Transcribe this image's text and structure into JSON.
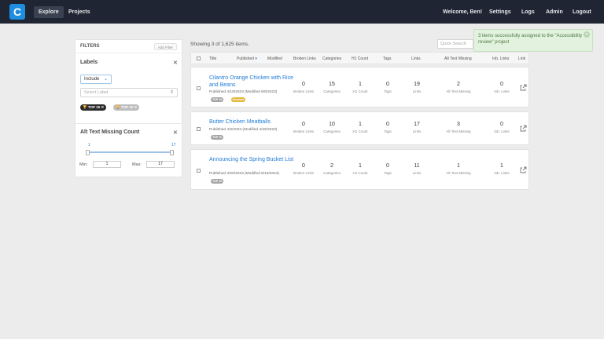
{
  "nav": {
    "logo": "C",
    "explore": "Explore",
    "projects": "Projects",
    "welcome": "Welcome, Ben!",
    "settings": "Settings",
    "logs": "Logs",
    "admin": "Admin",
    "logout": "Logout"
  },
  "filters": {
    "title": "FILTERS",
    "add_filter": "Add Filter",
    "labels": {
      "title": "Labels",
      "include": "Include",
      "select_placeholder": "Select Label",
      "chips": [
        "TOP 25",
        "TOP 10"
      ]
    },
    "alt_text": {
      "title": "Alt Text Missing Count",
      "slider_min": "1",
      "slider_max": "17",
      "min_label": "Min:",
      "max_label": "Max:",
      "min_value": "1",
      "max_value": "17"
    }
  },
  "main": {
    "showing": "Showing 3 of 1,625 items.",
    "search_placeholder": "Quick Search",
    "toast": "3 items successfully assigned to the \"Accessibility review\" project",
    "columns": [
      "Title",
      "Published",
      "Modified",
      "Broken Links",
      "Categories",
      "H1 Count",
      "Tags",
      "Links",
      "Alt Text Missing",
      "Inb. Links",
      "Link"
    ],
    "sub_labels": [
      "Broken Links",
      "Categories",
      "H1 Count",
      "Tags",
      "Links",
      "Alt Text Missing",
      "Inb. Links"
    ],
    "rows": [
      {
        "title": "Cilantro Orange Chicken with Rice and Beans",
        "meta": "Published 4/19/2023 (Modified 6/8/2023)",
        "tags": [
          "TOP 10",
          "Summer"
        ],
        "values": [
          "0",
          "15",
          "1",
          "0",
          "19",
          "2",
          "0"
        ]
      },
      {
        "title": "Butter Chicken Meatballs",
        "meta": "Published 4/3/2023 (Modified 4/26/2023)",
        "tags": [
          "TOP 10"
        ],
        "values": [
          "0",
          "10",
          "1",
          "0",
          "17",
          "3",
          "0"
        ]
      },
      {
        "title": "Announcing the Spring Bucket List",
        "meta": "Published 3/20/2023 (Modified 5/16/2023)",
        "tags": [
          "TOP 10"
        ],
        "values": [
          "0",
          "2",
          "1",
          "0",
          "11",
          "1",
          "1"
        ]
      }
    ]
  }
}
